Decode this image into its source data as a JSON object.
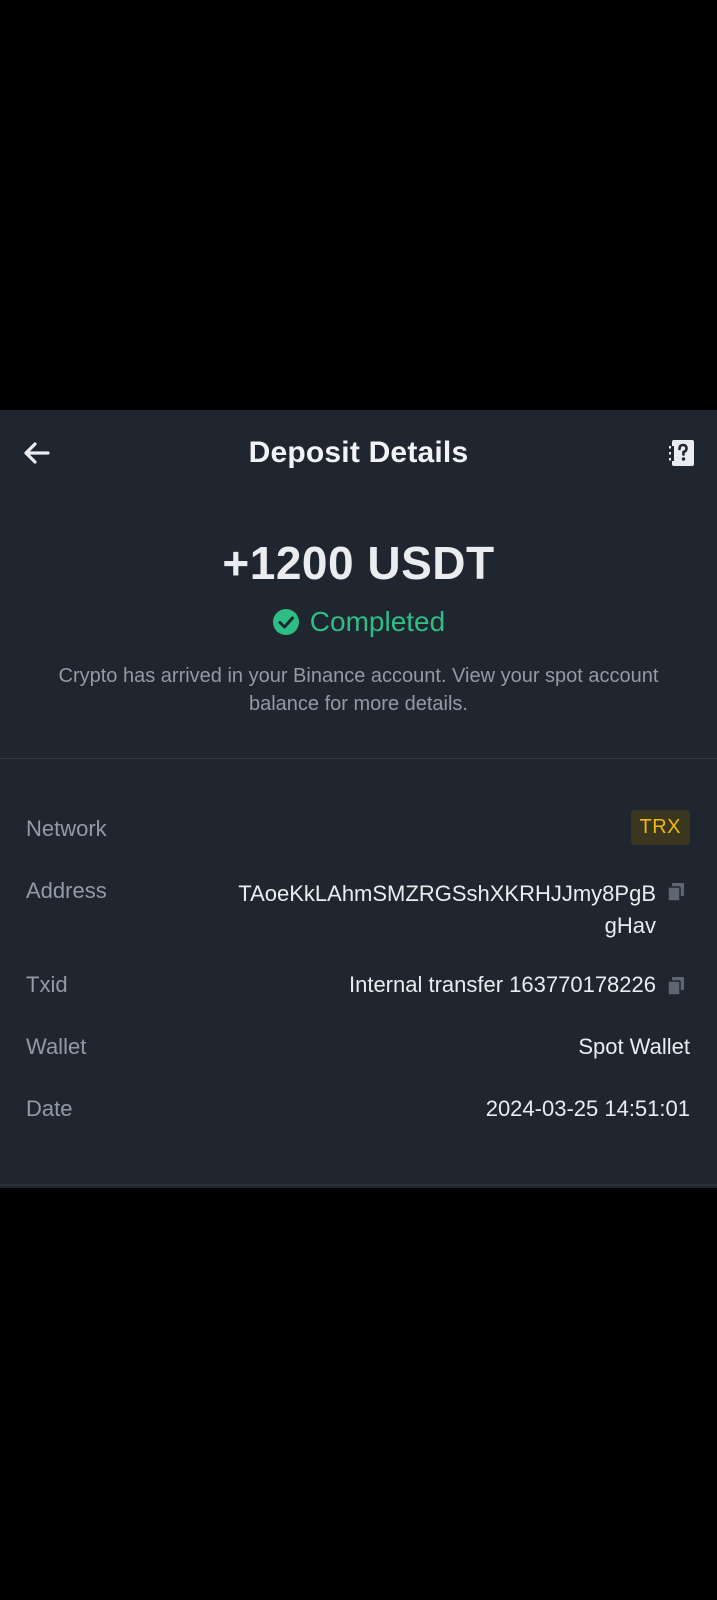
{
  "header": {
    "back_icon": "arrow-left-icon",
    "title": "Deposit Details",
    "help_icon": "help-document-icon"
  },
  "summary": {
    "amount": "+1200 USDT",
    "status": "Completed",
    "status_icon": "check-circle-icon",
    "message": "Crypto has arrived in your Binance account. View your spot account balance for more details."
  },
  "details": {
    "network": {
      "label": "Network",
      "value": "TRX"
    },
    "address": {
      "label": "Address",
      "value": "TAoeKkLAhmSMZRGSshXKRHJJmy8PgBgHav",
      "copy_icon": "copy-icon"
    },
    "txid": {
      "label": "Txid",
      "value": "Internal transfer 163770178226",
      "copy_icon": "copy-icon"
    },
    "wallet": {
      "label": "Wallet",
      "value": "Spot Wallet"
    },
    "date": {
      "label": "Date",
      "value": "2024-03-25 14:51:01"
    }
  },
  "colors": {
    "panel_bg": "#20262f",
    "status_green": "#2ebd85",
    "network_badge_yellow": "#f0b90b",
    "label_gray": "#929aa5",
    "value_white": "#eaecef"
  }
}
